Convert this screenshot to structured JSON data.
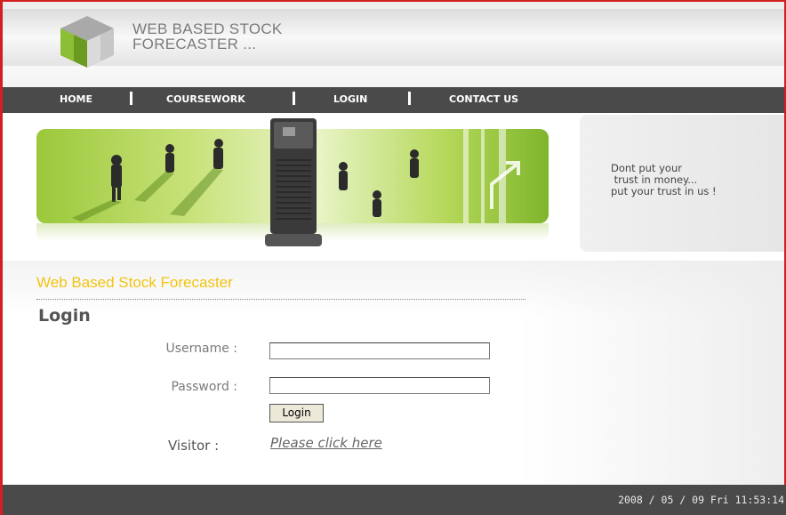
{
  "header": {
    "title_line1": "WEB BASED STOCK",
    "title_line2": "FORECASTER ...",
    "logo_icon": "green-cube-logo-icon"
  },
  "nav": {
    "items": [
      {
        "label": "HOME"
      },
      {
        "label": "COURSEWORK"
      },
      {
        "label": "LOGIN"
      },
      {
        "label": "CONTACT US"
      }
    ],
    "separator": "|"
  },
  "banner": {
    "tagline": "Dont put your\n trust in money...\nput your trust in us !"
  },
  "main": {
    "section_title": "Web Based Stock Forecaster",
    "login_heading": "Login",
    "username_label": "Username :",
    "username_value": "",
    "password_label": "Password :",
    "password_value": "",
    "login_button": "Login",
    "visitor_label": "Visitor :",
    "visitor_link": "Please click here"
  },
  "footer": {
    "datetime": "2008 / 05 / 09 Fri  11:53:14"
  },
  "colors": {
    "frame_border": "#d41f1f",
    "nav_bg": "#4a4a4a",
    "section_title": "#f2c311",
    "banner_green": "#9bc83a"
  }
}
